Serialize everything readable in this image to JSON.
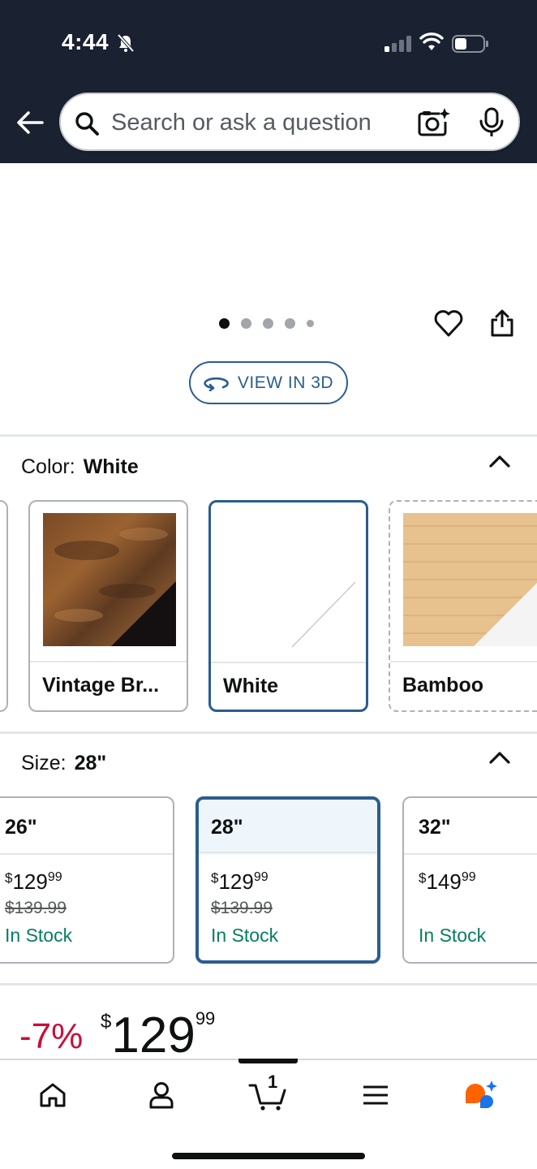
{
  "status_bar": {
    "time": "4:44"
  },
  "header": {
    "search": {
      "placeholder": "Search or ask a question"
    }
  },
  "image_carousel": {
    "dot_count": 5,
    "active_dot": 1
  },
  "view_3d": {
    "label": "VIEW IN 3D"
  },
  "color_section": {
    "label": "Color:",
    "selected": "White",
    "options": [
      {
        "name": "Vintage Br..."
      },
      {
        "name": "White"
      },
      {
        "name": "Bamboo"
      }
    ]
  },
  "size_section": {
    "label": "Size:",
    "selected": "28\"",
    "options": [
      {
        "name": "26\"",
        "currency": "$",
        "price_whole": "129",
        "price_fraction": "99",
        "list_price": "$139.99",
        "stock": "In Stock"
      },
      {
        "name": "28\"",
        "currency": "$",
        "price_whole": "129",
        "price_fraction": "99",
        "list_price": "$139.99",
        "stock": "In Stock"
      },
      {
        "name": "32\"",
        "currency": "$",
        "price_whole": "149",
        "price_fraction": "99",
        "list_price": "",
        "stock": "In Stock"
      }
    ]
  },
  "price_block": {
    "discount": "-7%",
    "currency": "$",
    "whole": "129",
    "fraction": "99"
  },
  "bottom_nav": {
    "cart_count": "1",
    "items": [
      "home-icon",
      "account-icon",
      "cart-icon",
      "menu-icon",
      "rufus-assistant-icon"
    ]
  },
  "colors": {
    "header_bg": "#1a2131",
    "selected_border": "#2a5d8f",
    "stock_green": "#067d62",
    "discount_red": "#cc0c39"
  }
}
